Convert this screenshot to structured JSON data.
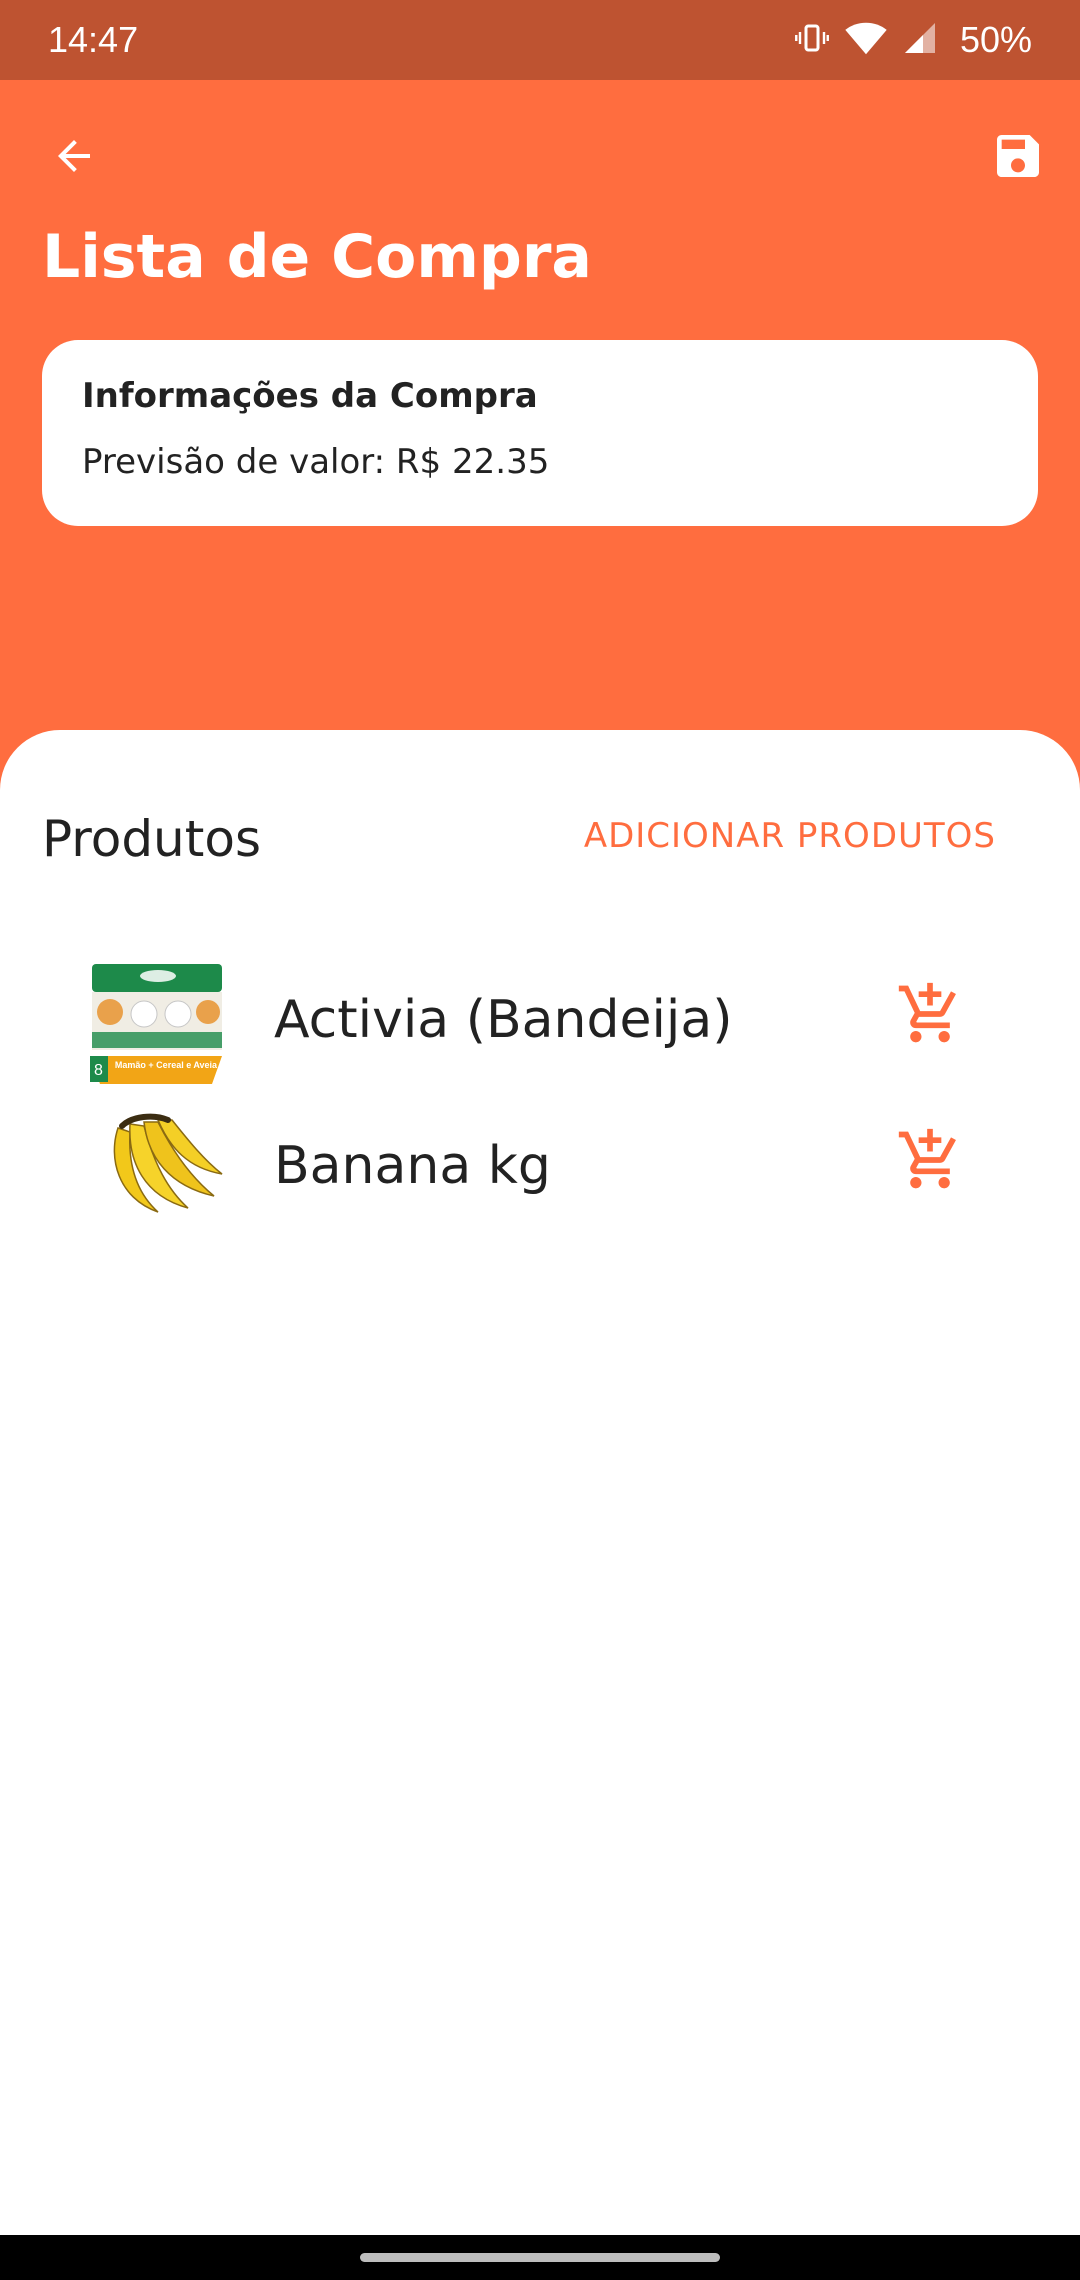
{
  "status_bar": {
    "time": "14:47",
    "battery": "50%",
    "icons": [
      "vibrate-icon",
      "wifi-icon",
      "signal-icon"
    ]
  },
  "header": {
    "title": "Lista de Compra",
    "back_icon": "arrow-back-icon",
    "save_icon": "save-floppy-icon"
  },
  "info_card": {
    "title": "Informações da Compra",
    "estimate": "Previsão de valor: R$ 22.35"
  },
  "products_section": {
    "title": "Produtos",
    "add_button_label": "ADICIONAR PRODUTOS",
    "items": [
      {
        "name": "Activia (Bandeija)",
        "image_text_count": "8",
        "image_text": "Mamão + Cereal e Aveia",
        "action_icon": "cart-add-icon"
      },
      {
        "name": "Banana kg",
        "action_icon": "cart-add-icon"
      }
    ]
  },
  "colors": {
    "primary": "#ff6d3f",
    "status_bar": "#be5331",
    "text": "#222222",
    "surface": "#ffffff"
  }
}
